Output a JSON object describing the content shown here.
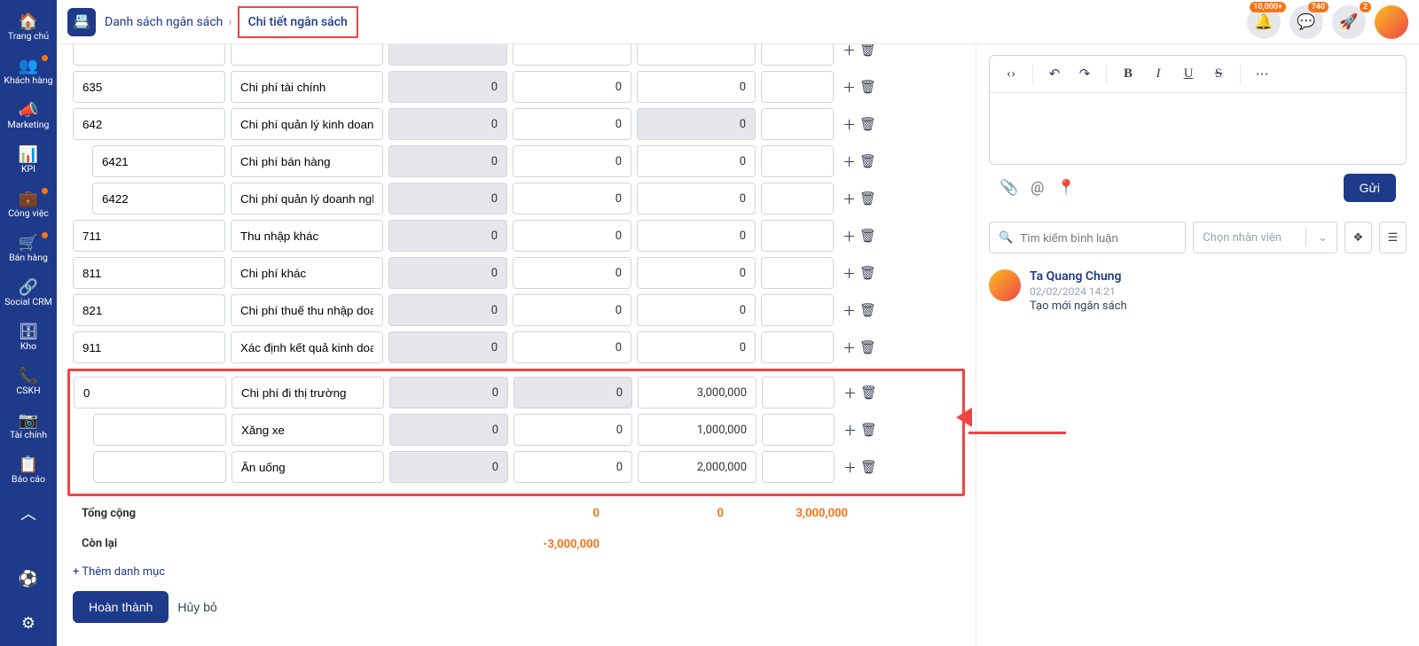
{
  "sidebar": {
    "items": [
      {
        "label": "Trang chủ",
        "icon": "🏠",
        "dot": false
      },
      {
        "label": "Khách hàng",
        "icon": "👥",
        "dot": true
      },
      {
        "label": "Marketing",
        "icon": "📣",
        "dot": false
      },
      {
        "label": "KPI",
        "icon": "📊",
        "dot": false
      },
      {
        "label": "Công việc",
        "icon": "💼",
        "dot": true
      },
      {
        "label": "Bán hàng",
        "icon": "🛒",
        "dot": true
      },
      {
        "label": "Social CRM",
        "icon": "🔗",
        "dot": false
      },
      {
        "label": "Kho",
        "icon": "🗄",
        "dot": false
      },
      {
        "label": "CSKH",
        "icon": "📞",
        "dot": false
      },
      {
        "label": "Tài chính",
        "icon": "📷",
        "dot": false
      },
      {
        "label": "Báo cáo",
        "icon": "📋",
        "dot": false
      }
    ],
    "collapse_icon": "︿",
    "bottom_icons": [
      "⚽",
      "⚙"
    ]
  },
  "header": {
    "breadcrumb": [
      "Danh sách ngân sách",
      "Chi tiết ngân sách"
    ],
    "notif": {
      "bell": "10,000+",
      "chat": "740",
      "rocket": "2"
    }
  },
  "rows": [
    {
      "code": "635",
      "name": "Chi phí tài chính",
      "v1": "0",
      "v2": "0",
      "v3": "0",
      "indent": false
    },
    {
      "code": "642",
      "name": "Chi phí quản lý kinh doanh",
      "v1": "0",
      "v2": "0",
      "v3": "0",
      "indent": false,
      "gray3": true
    },
    {
      "code": "6421",
      "name": "Chi phí bán hàng",
      "v1": "0",
      "v2": "0",
      "v3": "0",
      "indent": true
    },
    {
      "code": "6422",
      "name": "Chi phí quản lý doanh nghiệp",
      "v1": "0",
      "v2": "0",
      "v3": "0",
      "indent": true
    },
    {
      "code": "711",
      "name": "Thu nhập khác",
      "v1": "0",
      "v2": "0",
      "v3": "0",
      "indent": false
    },
    {
      "code": "811",
      "name": "Chi phí khác",
      "v1": "0",
      "v2": "0",
      "v3": "0",
      "indent": false
    },
    {
      "code": "821",
      "name": "Chi phí thuế thu nhập doanh nghiệp",
      "v1": "0",
      "v2": "0",
      "v3": "0",
      "indent": false
    },
    {
      "code": "911",
      "name": "Xác định kết quả kinh doanh",
      "v1": "0",
      "v2": "0",
      "v3": "0",
      "indent": false
    }
  ],
  "highlight_rows": [
    {
      "code": "0",
      "name": "Chi phí đi thị trường",
      "v1": "0",
      "v2": "0",
      "v3": "3,000,000",
      "indent": false,
      "gray2": true
    },
    {
      "code": "",
      "name": "Xăng xe",
      "v1": "0",
      "v2": "0",
      "v3": "1,000,000",
      "indent": true
    },
    {
      "code": "",
      "name": "Ăn uống",
      "v1": "0",
      "v2": "0",
      "v3": "2,000,000",
      "indent": true
    }
  ],
  "totals": {
    "label": "Tổng cộng",
    "v1": "0",
    "v2": "0",
    "v3": "3,000,000"
  },
  "remaining": {
    "label": "Còn lại",
    "val": "-3,000,000"
  },
  "add_link": "+ Thêm danh mục",
  "buttons": {
    "complete": "Hoàn thành",
    "cancel": "Hủy bỏ"
  },
  "right": {
    "send": "Gửi",
    "search_placeholder": "Tìm kiếm bình luận",
    "select_placeholder": "Chọn nhân viên",
    "comment": {
      "name": "Ta Quang Chung",
      "date": "02/02/2024 14:21",
      "text": "Tạo mới ngân sách"
    }
  }
}
